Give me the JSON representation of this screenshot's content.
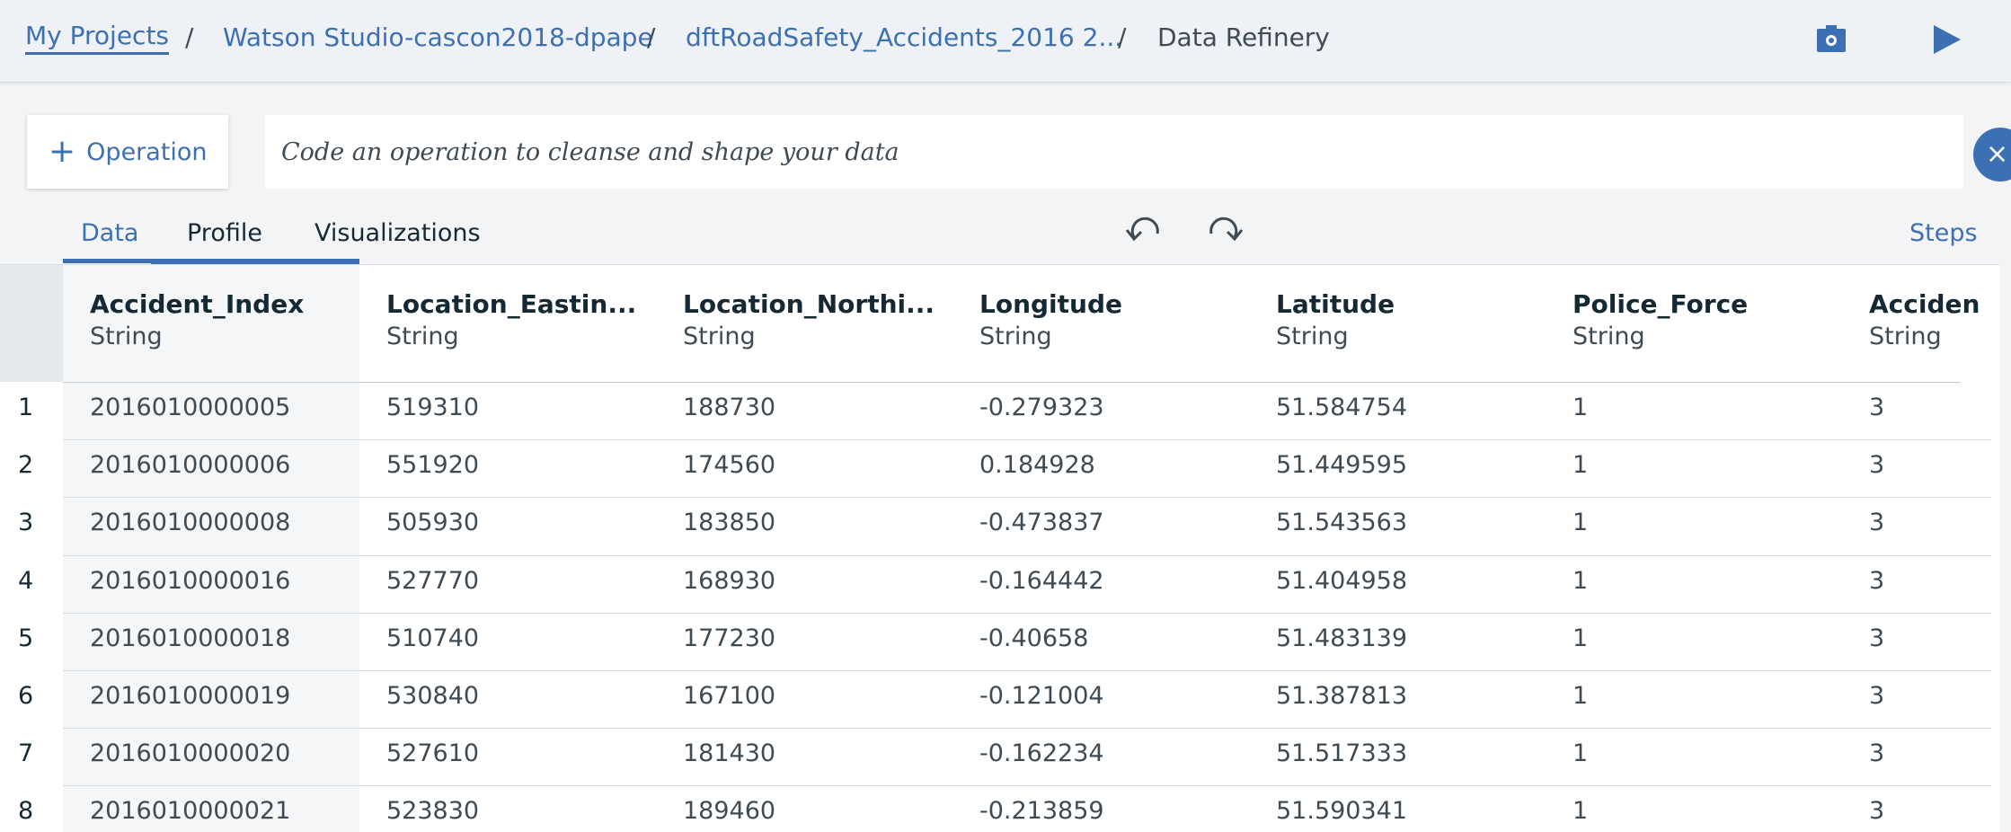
{
  "breadcrumb": {
    "items": [
      "My Projects",
      "Watson Studio-cascon2018-dpape",
      "dftRoadSafety_Accidents_2016 2...",
      "Data Refinery"
    ],
    "separator": "/"
  },
  "toolbar": {
    "icons": [
      "job-settings-icon",
      "run-play-icon"
    ]
  },
  "operation": {
    "button_label": "Operation",
    "plus_glyph": "+",
    "code_placeholder": "Code an operation to cleanse and shape your data",
    "close_glyph": "×"
  },
  "tabs": [
    {
      "label": "Data",
      "active": true
    },
    {
      "label": "Profile",
      "active": false
    },
    {
      "label": "Visualizations",
      "active": false
    }
  ],
  "steps_label": "Steps",
  "table": {
    "columns": [
      {
        "name": "Accident_Index",
        "type": "String"
      },
      {
        "name": "Location_Eastin...",
        "type": "String"
      },
      {
        "name": "Location_Northi...",
        "type": "String"
      },
      {
        "name": "Longitude",
        "type": "String"
      },
      {
        "name": "Latitude",
        "type": "String"
      },
      {
        "name": "Police_Force",
        "type": "String"
      },
      {
        "name": "Acciden",
        "type": "String"
      }
    ],
    "rows": [
      {
        "num": "1",
        "cells": [
          "2016010000005",
          "519310",
          "188730",
          "-0.279323",
          "51.584754",
          "1",
          "3"
        ]
      },
      {
        "num": "2",
        "cells": [
          "2016010000006",
          "551920",
          "174560",
          "0.184928",
          "51.449595",
          "1",
          "3"
        ]
      },
      {
        "num": "3",
        "cells": [
          "2016010000008",
          "505930",
          "183850",
          "-0.473837",
          "51.543563",
          "1",
          "3"
        ]
      },
      {
        "num": "4",
        "cells": [
          "2016010000016",
          "527770",
          "168930",
          "-0.164442",
          "51.404958",
          "1",
          "3"
        ]
      },
      {
        "num": "5",
        "cells": [
          "2016010000018",
          "510740",
          "177230",
          "-0.40658",
          "51.483139",
          "1",
          "3"
        ]
      },
      {
        "num": "6",
        "cells": [
          "2016010000019",
          "530840",
          "167100",
          "-0.121004",
          "51.387813",
          "1",
          "3"
        ]
      },
      {
        "num": "7",
        "cells": [
          "2016010000020",
          "527610",
          "181430",
          "-0.162234",
          "51.517333",
          "1",
          "3"
        ]
      },
      {
        "num": "8",
        "cells": [
          "2016010000021",
          "523830",
          "189460",
          "-0.213859",
          "51.590341",
          "1",
          "3"
        ]
      }
    ]
  },
  "colors": {
    "accent": "#3d70b2",
    "text": "#152935",
    "muted_text": "#3f4b54",
    "page_bg": "#f3f4f6"
  }
}
